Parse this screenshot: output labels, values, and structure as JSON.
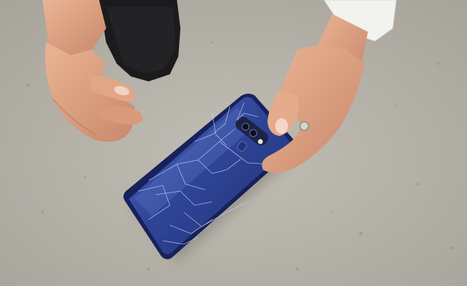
{
  "scene": {
    "description_colors": {
      "concrete": "#b9b6ad",
      "concrete_dark": "#a39f96",
      "phone_blue": "#2a3f8f",
      "phone_blue_light": "#4a62b8",
      "phone_edge": "#1a2560",
      "skin": "#e3a887",
      "skin_shadow": "#c47f61",
      "sleeve": "#f4f4f2",
      "shoe": "#1c1c1e"
    }
  }
}
